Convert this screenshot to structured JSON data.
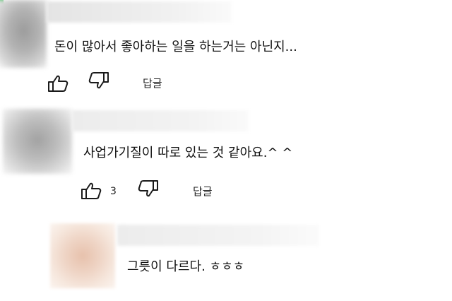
{
  "comments": [
    {
      "text": "돈이 많아서  좋아하는 일을 하는거는 아닌지...",
      "like_count": "",
      "reply_label": "답글"
    },
    {
      "text": "사업가기질이 따로 있는 것 같아요.^ ^",
      "like_count": "3",
      "reply_label": "답글"
    },
    {
      "text": "그릇이 다르다. ㅎㅎㅎ"
    }
  ],
  "icons": {
    "like": "thumbs-up-icon",
    "dislike": "thumbs-down-icon"
  },
  "colors": {
    "text": "#111111",
    "accent_corner": "#3cc05a"
  }
}
